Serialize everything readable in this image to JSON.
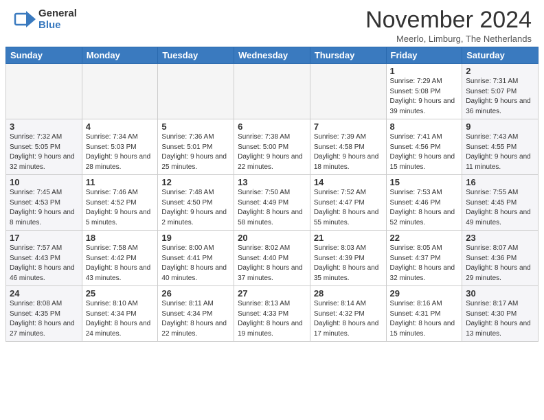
{
  "logo": {
    "line1": "General",
    "line2": "Blue"
  },
  "title": "November 2024",
  "location": "Meerlo, Limburg, The Netherlands",
  "weekdays": [
    "Sunday",
    "Monday",
    "Tuesday",
    "Wednesday",
    "Thursday",
    "Friday",
    "Saturday"
  ],
  "weeks": [
    [
      {
        "day": "",
        "info": ""
      },
      {
        "day": "",
        "info": ""
      },
      {
        "day": "",
        "info": ""
      },
      {
        "day": "",
        "info": ""
      },
      {
        "day": "",
        "info": ""
      },
      {
        "day": "1",
        "info": "Sunrise: 7:29 AM\nSunset: 5:08 PM\nDaylight: 9 hours and 39 minutes."
      },
      {
        "day": "2",
        "info": "Sunrise: 7:31 AM\nSunset: 5:07 PM\nDaylight: 9 hours and 36 minutes."
      }
    ],
    [
      {
        "day": "3",
        "info": "Sunrise: 7:32 AM\nSunset: 5:05 PM\nDaylight: 9 hours and 32 minutes."
      },
      {
        "day": "4",
        "info": "Sunrise: 7:34 AM\nSunset: 5:03 PM\nDaylight: 9 hours and 28 minutes."
      },
      {
        "day": "5",
        "info": "Sunrise: 7:36 AM\nSunset: 5:01 PM\nDaylight: 9 hours and 25 minutes."
      },
      {
        "day": "6",
        "info": "Sunrise: 7:38 AM\nSunset: 5:00 PM\nDaylight: 9 hours and 22 minutes."
      },
      {
        "day": "7",
        "info": "Sunrise: 7:39 AM\nSunset: 4:58 PM\nDaylight: 9 hours and 18 minutes."
      },
      {
        "day": "8",
        "info": "Sunrise: 7:41 AM\nSunset: 4:56 PM\nDaylight: 9 hours and 15 minutes."
      },
      {
        "day": "9",
        "info": "Sunrise: 7:43 AM\nSunset: 4:55 PM\nDaylight: 9 hours and 11 minutes."
      }
    ],
    [
      {
        "day": "10",
        "info": "Sunrise: 7:45 AM\nSunset: 4:53 PM\nDaylight: 9 hours and 8 minutes."
      },
      {
        "day": "11",
        "info": "Sunrise: 7:46 AM\nSunset: 4:52 PM\nDaylight: 9 hours and 5 minutes."
      },
      {
        "day": "12",
        "info": "Sunrise: 7:48 AM\nSunset: 4:50 PM\nDaylight: 9 hours and 2 minutes."
      },
      {
        "day": "13",
        "info": "Sunrise: 7:50 AM\nSunset: 4:49 PM\nDaylight: 8 hours and 58 minutes."
      },
      {
        "day": "14",
        "info": "Sunrise: 7:52 AM\nSunset: 4:47 PM\nDaylight: 8 hours and 55 minutes."
      },
      {
        "day": "15",
        "info": "Sunrise: 7:53 AM\nSunset: 4:46 PM\nDaylight: 8 hours and 52 minutes."
      },
      {
        "day": "16",
        "info": "Sunrise: 7:55 AM\nSunset: 4:45 PM\nDaylight: 8 hours and 49 minutes."
      }
    ],
    [
      {
        "day": "17",
        "info": "Sunrise: 7:57 AM\nSunset: 4:43 PM\nDaylight: 8 hours and 46 minutes."
      },
      {
        "day": "18",
        "info": "Sunrise: 7:58 AM\nSunset: 4:42 PM\nDaylight: 8 hours and 43 minutes."
      },
      {
        "day": "19",
        "info": "Sunrise: 8:00 AM\nSunset: 4:41 PM\nDaylight: 8 hours and 40 minutes."
      },
      {
        "day": "20",
        "info": "Sunrise: 8:02 AM\nSunset: 4:40 PM\nDaylight: 8 hours and 37 minutes."
      },
      {
        "day": "21",
        "info": "Sunrise: 8:03 AM\nSunset: 4:39 PM\nDaylight: 8 hours and 35 minutes."
      },
      {
        "day": "22",
        "info": "Sunrise: 8:05 AM\nSunset: 4:37 PM\nDaylight: 8 hours and 32 minutes."
      },
      {
        "day": "23",
        "info": "Sunrise: 8:07 AM\nSunset: 4:36 PM\nDaylight: 8 hours and 29 minutes."
      }
    ],
    [
      {
        "day": "24",
        "info": "Sunrise: 8:08 AM\nSunset: 4:35 PM\nDaylight: 8 hours and 27 minutes."
      },
      {
        "day": "25",
        "info": "Sunrise: 8:10 AM\nSunset: 4:34 PM\nDaylight: 8 hours and 24 minutes."
      },
      {
        "day": "26",
        "info": "Sunrise: 8:11 AM\nSunset: 4:34 PM\nDaylight: 8 hours and 22 minutes."
      },
      {
        "day": "27",
        "info": "Sunrise: 8:13 AM\nSunset: 4:33 PM\nDaylight: 8 hours and 19 minutes."
      },
      {
        "day": "28",
        "info": "Sunrise: 8:14 AM\nSunset: 4:32 PM\nDaylight: 8 hours and 17 minutes."
      },
      {
        "day": "29",
        "info": "Sunrise: 8:16 AM\nSunset: 4:31 PM\nDaylight: 8 hours and 15 minutes."
      },
      {
        "day": "30",
        "info": "Sunrise: 8:17 AM\nSunset: 4:30 PM\nDaylight: 8 hours and 13 minutes."
      }
    ]
  ]
}
